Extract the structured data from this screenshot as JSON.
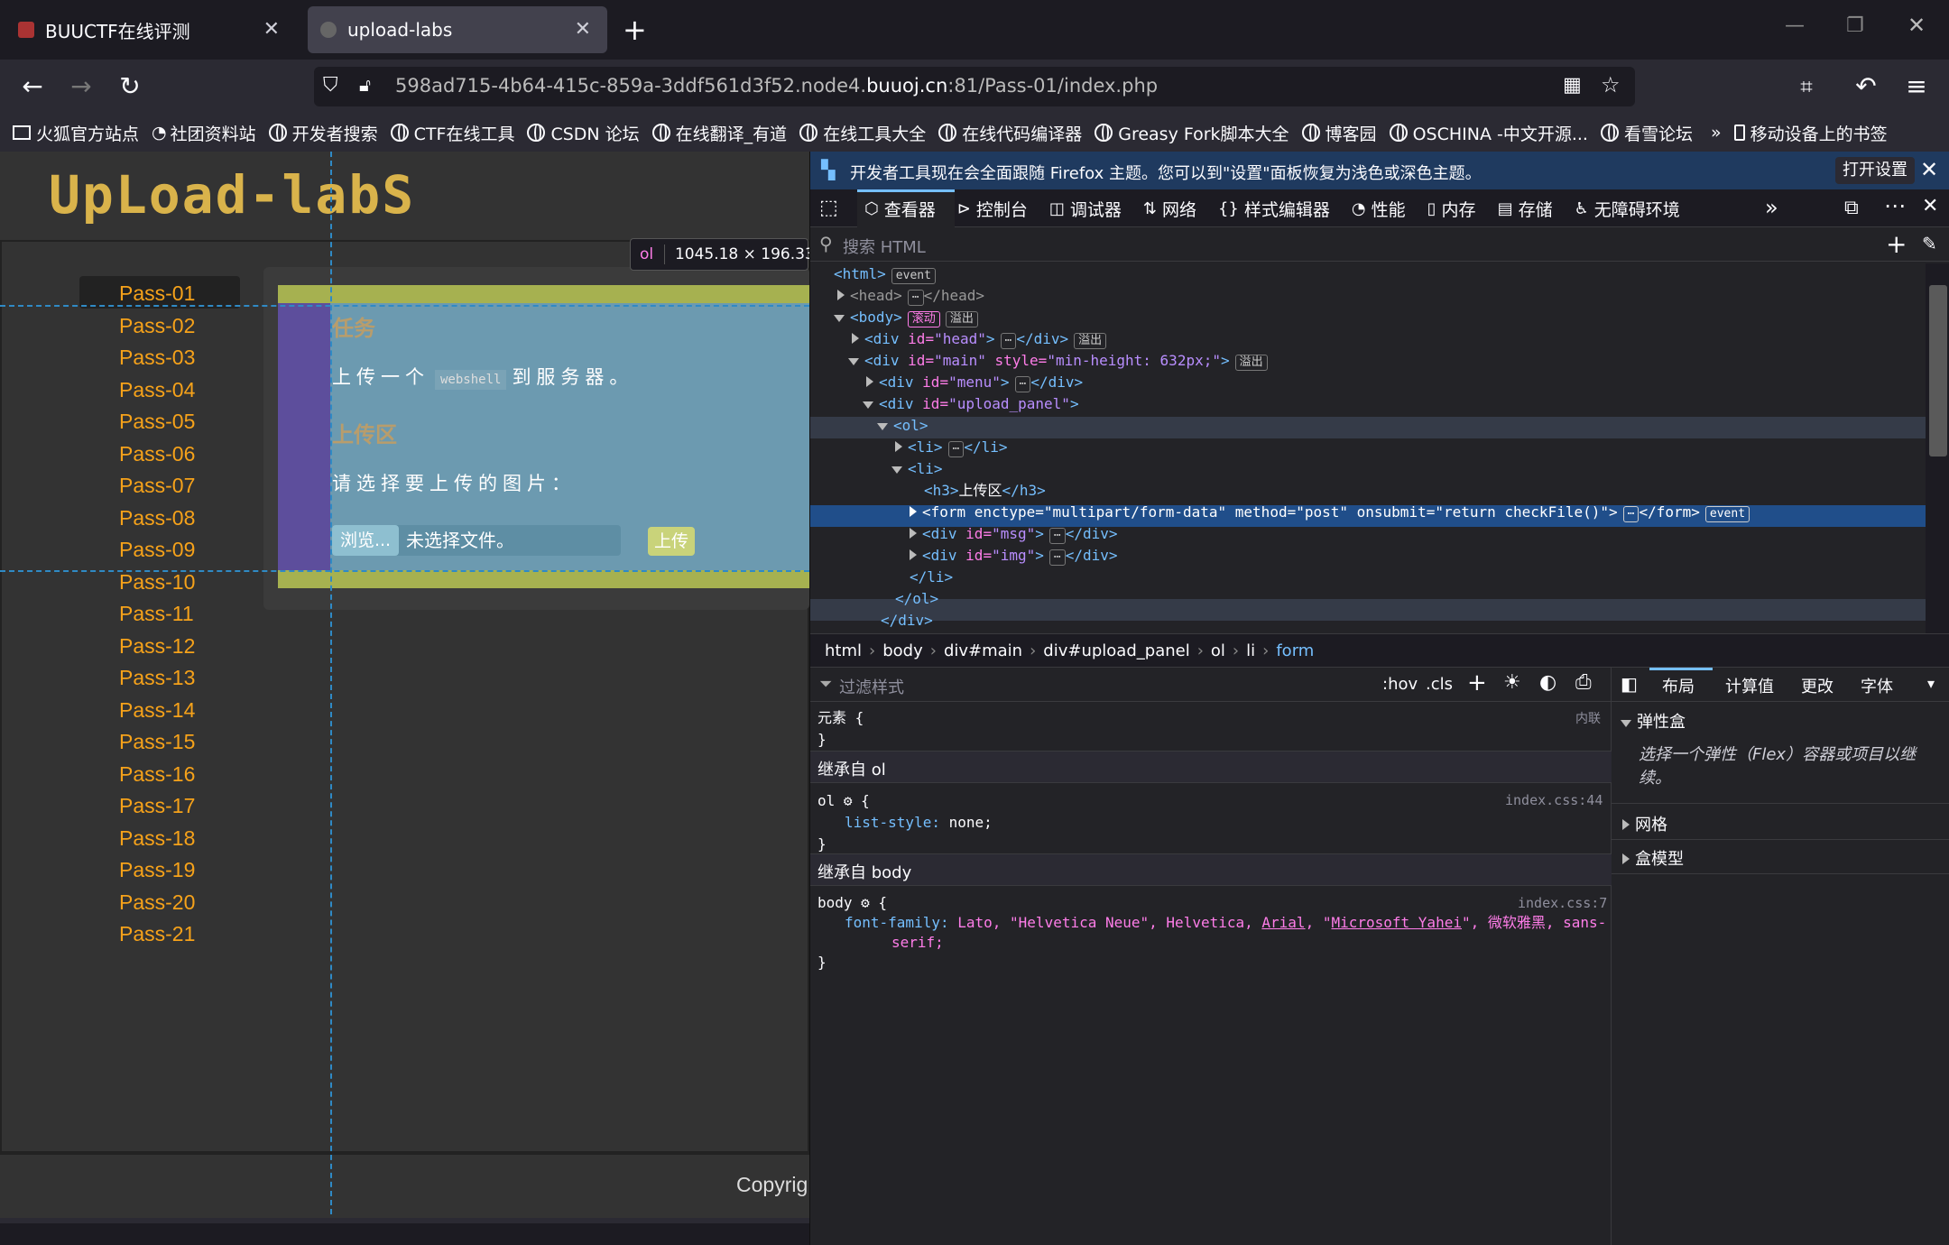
{
  "tabs": [
    {
      "title": "BUUCTF在线评测",
      "active": false
    },
    {
      "title": "upload-labs",
      "active": true
    }
  ],
  "url": {
    "prefix": "598ad715-4b64-415c-859a-3ddf561d3f52.node4.",
    "domain": "buuoj.cn",
    "suffix": ":81/Pass-01/index.php"
  },
  "bookmarks": [
    "火狐官方站点",
    "社团资料站",
    "开发者搜索",
    "CTF在线工具",
    "CSDN 论坛",
    "在线翻译_有道",
    "在线工具大全",
    "在线代码编译器",
    "Greasy Fork脚本大全",
    "博客园",
    "OSCHINA -中文开源...",
    "看雪论坛"
  ],
  "bookmarks_mobile": "移动设备上的书签",
  "page": {
    "logo": "UpLoad-labS",
    "passes": [
      "Pass-01",
      "Pass-02",
      "Pass-03",
      "Pass-04",
      "Pass-05",
      "Pass-06",
      "Pass-07",
      "Pass-08",
      "Pass-09",
      "Pass-10",
      "Pass-11",
      "Pass-12",
      "Pass-13",
      "Pass-14",
      "Pass-15",
      "Pass-16",
      "Pass-17",
      "Pass-18",
      "Pass-19",
      "Pass-20",
      "Pass-21"
    ],
    "task_title": "任务",
    "task_text_a": "上传一个",
    "task_code": "webshell",
    "task_text_b": "到服务器。",
    "upload_title": "上传区",
    "upload_prompt": "请选择要上传的图片：",
    "browse_label": "浏览...",
    "no_file": "未选择文件。",
    "upload_button": "上传",
    "copyright": "Copyrig",
    "tooltip_tag": "ol",
    "tooltip_size": "1045.18 × 196.333"
  },
  "devtools": {
    "notice": "开发者工具现在会全面跟随 Firefox 主题。您可以到\"设置\"面板恢复为浅色或深色主题。",
    "notice_button": "打开设置",
    "tabs": [
      "查看器",
      "控制台",
      "调试器",
      "网络",
      "样式编辑器",
      "性能",
      "内存",
      "存储",
      "无障碍环境"
    ],
    "search_placeholder": "搜索 HTML",
    "breadcrumbs": [
      "html",
      "body",
      "div#main",
      "div#upload_panel",
      "ol",
      "li",
      "form"
    ],
    "filter_placeholder": "过滤样式",
    "hov": ":hov",
    "cls": ".cls",
    "layout_tabs": [
      "布局",
      "计算值",
      "更改",
      "字体"
    ],
    "flex_title": "弹性盒",
    "flex_hint": "选择一个弹性（Flex）容器或项目以继续。",
    "grid_title": "网格",
    "box_title": "盒模型",
    "rules": {
      "element_label": "元素 {",
      "element_src": "内联",
      "inherit_ol": "继承自 ol",
      "ol_selector": "ol",
      "ol_src": "index.css:44",
      "ol_prop": "list-style:",
      "ol_val": "none;",
      "inherit_body": "继承自 body",
      "body_selector": "body",
      "body_src": "index.css:7",
      "body_prop": "font-family:",
      "body_val_a": "Lato, \"Helvetica Neue\", Helvetica, ",
      "body_val_arial": "Arial",
      "body_val_b": ", \"",
      "body_val_yahei": "Microsoft Yahei",
      "body_val_c": "\", 微软雅黑, sans-",
      "body_val_d": "serif;"
    },
    "markup": {
      "event": "event",
      "scroll": "滚动",
      "overflow": "溢出",
      "main_style": "min-height: 632px;",
      "h3": "上传区",
      "form_attrs": "enctype=\"multipart/form-data\" method=\"post\" onsubmit=\"return checkFile()\""
    }
  }
}
